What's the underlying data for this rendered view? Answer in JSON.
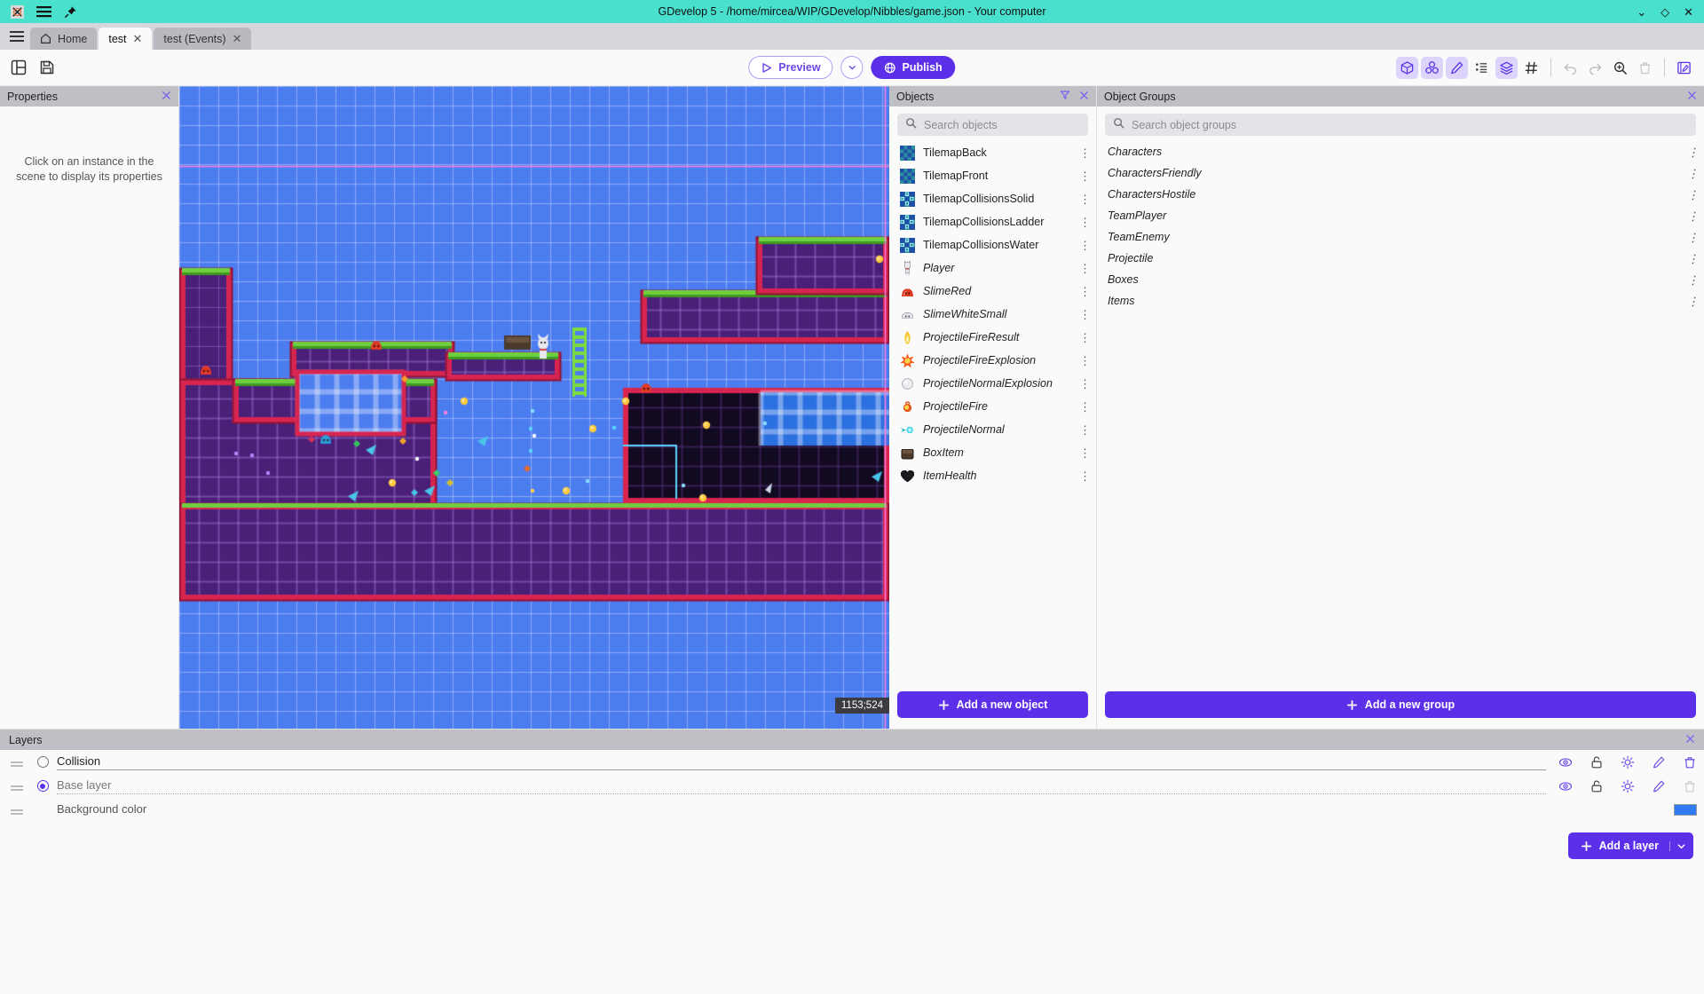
{
  "titlebar": {
    "title": "GDevelop 5 - /home/mircea/WIP/GDevelop/Nibbles/game.json - Your computer",
    "app_icon": "x-logo-icon",
    "menu_icon": "hamburger-icon",
    "pin_icon": "pin-icon",
    "minimize": "⌄",
    "maximize": "◇",
    "close": "✕",
    "accent": "#4ae0ce"
  },
  "tabs": [
    {
      "label": "Home",
      "icon": "home-icon",
      "active": false,
      "closable": false
    },
    {
      "label": "test",
      "active": true,
      "closable": true
    },
    {
      "label": "test (Events)",
      "active": false,
      "closable": true
    }
  ],
  "toolbar": {
    "left_icons": [
      "panels-layout-icon",
      "save-icon"
    ],
    "preview_label": "Preview",
    "preview_icon": "play-icon",
    "preview_caret_icon": "chevron-down-icon",
    "publish_label": "Publish",
    "publish_icon": "globe-icon",
    "right_icons": [
      {
        "name": "cube-3d-icon",
        "active": true
      },
      {
        "name": "objects-stack-icon",
        "active": true
      },
      {
        "name": "pencil-edit-icon",
        "active": true
      },
      {
        "name": "instances-list-icon",
        "active": false
      },
      {
        "name": "layers-icon",
        "active": true
      },
      {
        "name": "grid-icon",
        "active": false
      },
      {
        "name": "undo-icon",
        "active": false,
        "disabled": true
      },
      {
        "name": "redo-icon",
        "active": false,
        "disabled": true
      },
      {
        "name": "zoom-icon",
        "active": false
      },
      {
        "name": "trash-icon",
        "active": false,
        "disabled": true
      },
      {
        "name": "open-editor-icon",
        "active": false
      }
    ],
    "accent": "#5b30e8"
  },
  "properties": {
    "title": "Properties",
    "close_icon": "close-icon",
    "empty_message": "Click on an instance in the scene to display its properties"
  },
  "scene": {
    "coordinates": "1153;524",
    "background_color": "#4c7df0"
  },
  "objects_panel": {
    "title": "Objects",
    "filter_icon": "filter-icon",
    "close_icon": "close-icon",
    "search_placeholder": "Search objects",
    "search_value": "",
    "search_icon": "search-icon",
    "add_label": "Add a new object",
    "add_icon": "plus-icon",
    "items": [
      {
        "name": "TilemapBack",
        "thumb": "tilemap-icon",
        "italic": false
      },
      {
        "name": "TilemapFront",
        "thumb": "tilemap-icon",
        "italic": false
      },
      {
        "name": "TilemapCollisionsSolid",
        "thumb": "tilemap2-icon",
        "italic": false
      },
      {
        "name": "TilemapCollisionsLadder",
        "thumb": "tilemap2-icon",
        "italic": false
      },
      {
        "name": "TilemapCollisionsWater",
        "thumb": "tilemap2-icon",
        "italic": false
      },
      {
        "name": "Player",
        "thumb": "player-icon",
        "italic": true
      },
      {
        "name": "SlimeRed",
        "thumb": "slime-red-icon",
        "italic": true
      },
      {
        "name": "SlimeWhiteSmall",
        "thumb": "slime-white-icon",
        "italic": true
      },
      {
        "name": "ProjectileFireResult",
        "thumb": "flame-icon",
        "italic": true
      },
      {
        "name": "ProjectileFireExplosion",
        "thumb": "explosion-icon",
        "italic": true
      },
      {
        "name": "ProjectileNormalExplosion",
        "thumb": "puff-icon",
        "italic": true
      },
      {
        "name": "ProjectileFire",
        "thumb": "fireball-icon",
        "italic": true
      },
      {
        "name": "ProjectileNormal",
        "thumb": "bullet-icon",
        "italic": true
      },
      {
        "name": "BoxItem",
        "thumb": "box-icon",
        "italic": true
      },
      {
        "name": "ItemHealth",
        "thumb": "heart-icon",
        "italic": true
      }
    ],
    "row_menu_icon": "kebab-menu-icon"
  },
  "groups_panel": {
    "title": "Object Groups",
    "close_icon": "close-icon",
    "search_placeholder": "Search object groups",
    "search_value": "",
    "search_icon": "search-icon",
    "add_label": "Add a new group",
    "add_icon": "plus-icon",
    "row_menu_icon": "kebab-menu-icon",
    "items": [
      {
        "name": "Characters"
      },
      {
        "name": "CharactersFriendly"
      },
      {
        "name": "CharactersHostile"
      },
      {
        "name": "TeamPlayer"
      },
      {
        "name": "TeamEnemy"
      },
      {
        "name": "Projectile"
      },
      {
        "name": "Boxes"
      },
      {
        "name": "Items"
      }
    ]
  },
  "layers_panel": {
    "title": "Layers",
    "close_icon": "close-icon",
    "add_label": "Add a layer",
    "add_icon": "plus-icon",
    "add_caret_icon": "chevron-down-icon",
    "background_color_label": "Background color",
    "background_color_value": "#2f7bf6",
    "action_icons": [
      "eye-icon",
      "unlock-icon",
      "brightness-icon",
      "pencil-icon",
      "trash-icon"
    ],
    "rows": [
      {
        "name": "Collision",
        "selected": false,
        "style": "underline",
        "trash_disabled": false
      },
      {
        "name": "Base layer",
        "selected": true,
        "style": "dotted",
        "trash_disabled": true
      }
    ]
  }
}
